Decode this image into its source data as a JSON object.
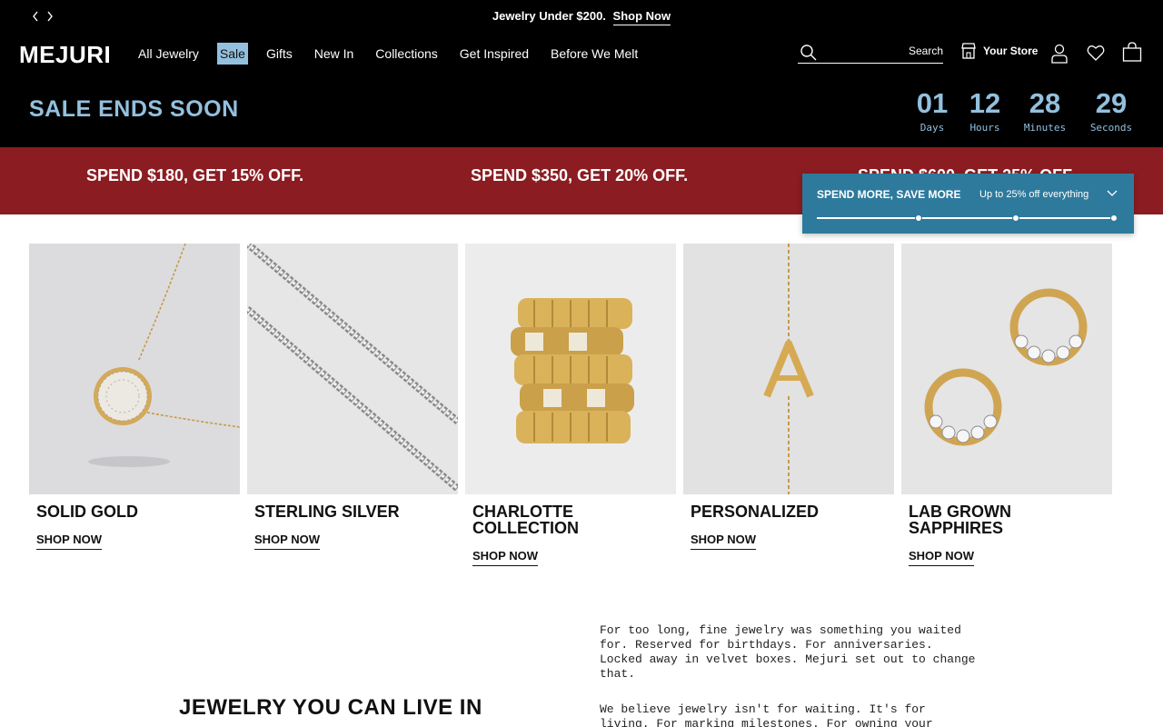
{
  "announcement": {
    "text": "Jewelry Under $200.",
    "link": "Shop Now"
  },
  "header": {
    "logo": "MEJURI",
    "nav": [
      "All Jewelry",
      "Sale",
      "Gifts",
      "New In",
      "Collections",
      "Get Inspired",
      "Before We Melt"
    ],
    "search_label": "Search",
    "store_label": "Your Store",
    "icons": [
      "search-icon",
      "store-icon",
      "account-icon",
      "heart-icon",
      "bag-icon"
    ]
  },
  "countdown": {
    "title": "SALE ENDS SOON",
    "units": [
      {
        "value": "01",
        "label": "Days"
      },
      {
        "value": "12",
        "label": "Hours"
      },
      {
        "value": "28",
        "label": "Minutes"
      },
      {
        "value": "29",
        "label": "Seconds"
      }
    ]
  },
  "promo": {
    "tiers": [
      "SPEND $180, GET 15% OFF.",
      "SPEND $350, GET 20% OFF.",
      "SPEND $600, GET 25% OFF."
    ]
  },
  "widget": {
    "title": "SPEND MORE, SAVE MORE",
    "subtitle": "Up to 25% off everything"
  },
  "categories": [
    {
      "name": "SOLID GOLD",
      "cta": "SHOP NOW"
    },
    {
      "name": "STERLING SILVER",
      "cta": "SHOP NOW"
    },
    {
      "name": "CHARLOTTE COLLECTION",
      "cta": "SHOP NOW"
    },
    {
      "name": "PERSONALIZED",
      "cta": "SHOP NOW"
    },
    {
      "name": "LAB GROWN SAPPHIRES",
      "cta": "SHOP NOW"
    }
  ],
  "story": {
    "title": "JEWELRY YOU CAN LIVE IN",
    "paragraphs": [
      "For too long, fine jewelry was something you waited for. Reserved for birthdays. For anniversaries. Locked away in velvet boxes. Mejuri set out to change that.",
      "We believe jewelry isn't for waiting. It's for living. For marking milestones. For owning your"
    ]
  },
  "colors": {
    "accent_blue": "#93c0de",
    "promo_red": "#8b1c21",
    "widget_teal": "#2e7a9c"
  }
}
